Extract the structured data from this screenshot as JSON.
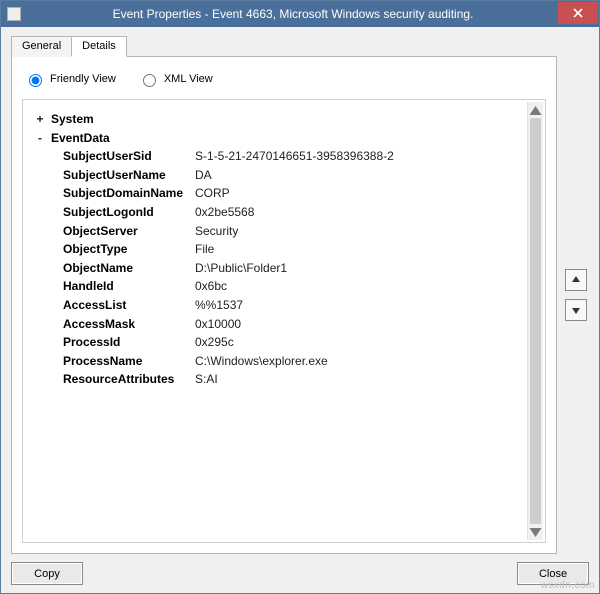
{
  "titlebar": {
    "title": "Event Properties - Event 4663, Microsoft Windows security auditing."
  },
  "tabs": {
    "general": "General",
    "details": "Details"
  },
  "views": {
    "friendly": "Friendly View",
    "xml": "XML View"
  },
  "tree": {
    "system_label": "System",
    "eventdata_label": "EventData",
    "fields": [
      {
        "key": "SubjectUserSid",
        "val": "S-1-5-21-2470146651-3958396388-2"
      },
      {
        "key": "SubjectUserName",
        "val": "DA"
      },
      {
        "key": "SubjectDomainName",
        "val": "CORP"
      },
      {
        "key": "SubjectLogonId",
        "val": "0x2be5568"
      },
      {
        "key": "ObjectServer",
        "val": "Security"
      },
      {
        "key": "ObjectType",
        "val": "File"
      },
      {
        "key": "ObjectName",
        "val": "D:\\Public\\Folder1"
      },
      {
        "key": "HandleId",
        "val": "0x6bc"
      },
      {
        "key": "AccessList",
        "val": "%%1537"
      },
      {
        "key": "AccessMask",
        "val": "0x10000"
      },
      {
        "key": "ProcessId",
        "val": "0x295c"
      },
      {
        "key": "ProcessName",
        "val": "C:\\Windows\\explorer.exe"
      },
      {
        "key": "ResourceAttributes",
        "val": "S:AI"
      }
    ]
  },
  "buttons": {
    "copy": "Copy",
    "close": "Close"
  },
  "watermark": "wsxdn.com"
}
